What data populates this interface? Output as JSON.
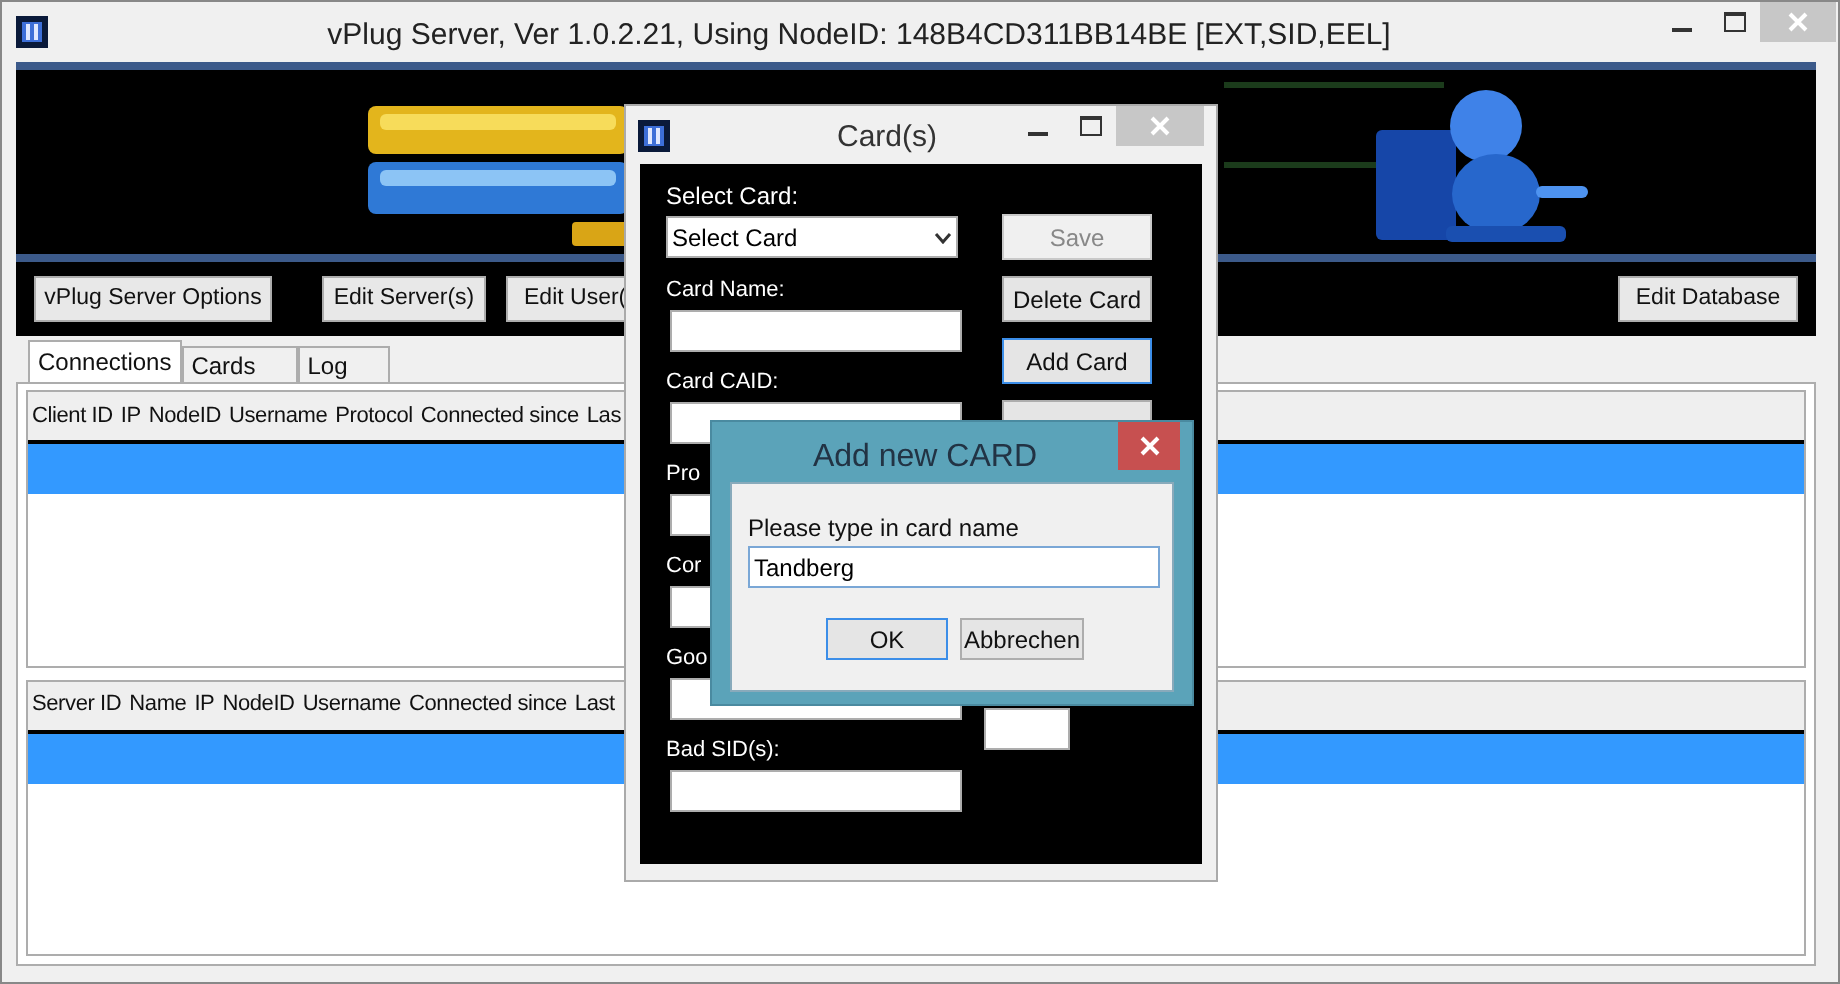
{
  "main_window": {
    "title": "vPlug Server,  Ver 1.0.2.21, Using NodeID: 148B4CD311BB14BE [EXT,SID,EEL]",
    "toolbar_buttons": [
      {
        "label": "vPlug Server Options"
      },
      {
        "label": "Edit Server(s)"
      },
      {
        "label": "Edit User("
      },
      {
        "label": "Edit Database"
      }
    ],
    "tabs": [
      {
        "label": "Connections",
        "selected": true
      },
      {
        "label": "Cards",
        "selected": false
      },
      {
        "label": "Log",
        "selected": false
      }
    ],
    "lists": [
      {
        "columns": [
          "Client ID",
          "IP",
          "NodeID",
          "Username",
          "Protocol",
          "Connected since",
          "Las"
        ],
        "rows": [
          {
            "selected": true
          }
        ]
      },
      {
        "columns": [
          "Server ID",
          "Name",
          "IP",
          "NodeID",
          "Username",
          "Connected since",
          "Last"
        ],
        "rows": [
          {
            "selected": true
          }
        ]
      }
    ]
  },
  "card_window": {
    "title": "Card(s)",
    "select": {
      "label": "Select Card:",
      "value": "Select Card"
    },
    "fields": [
      {
        "label": "Card Name:"
      },
      {
        "label": "Card CAID:"
      },
      {
        "label": "Pro"
      },
      {
        "label": "Cor"
      },
      {
        "label": "Goo",
        "extra_field": true
      },
      {
        "label": "Bad SID(s):"
      }
    ],
    "buttons": [
      {
        "label": "Save",
        "disabled": true,
        "focused": false
      },
      {
        "label": "Delete Card",
        "disabled": false,
        "focused": false
      },
      {
        "label": "Add Card",
        "disabled": false,
        "focused": true
      },
      {
        "disabled": false,
        "focused": false
      }
    ]
  },
  "add_dialog": {
    "title": "Add new CARD",
    "prompt": "Please type in card name",
    "value": "Tandberg",
    "buttons": [
      {
        "label": "OK",
        "focused": true
      },
      {
        "label": "Abbrechen",
        "focused": false
      }
    ]
  }
}
